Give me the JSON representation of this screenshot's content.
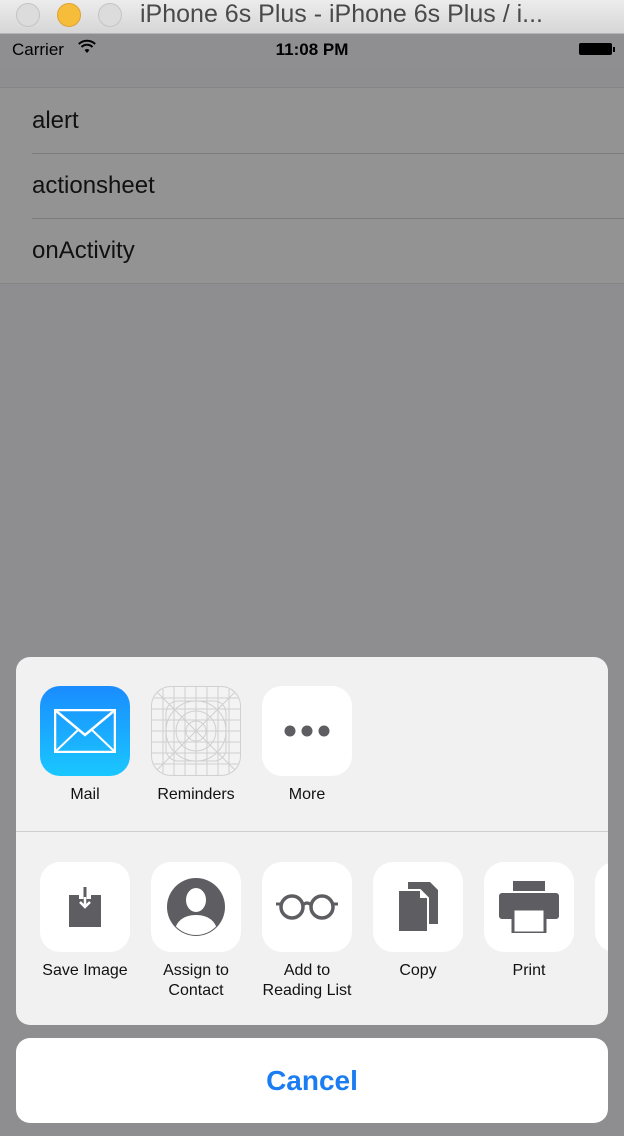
{
  "window": {
    "title": "iPhone 6s Plus - iPhone 6s Plus / i..."
  },
  "statusbar": {
    "carrier": "Carrier",
    "time": "11:08 PM"
  },
  "table": {
    "rows": [
      "alert",
      "actionsheet",
      "onActivity"
    ]
  },
  "share_row": [
    {
      "label": "Mail",
      "icon": "mail-icon"
    },
    {
      "label": "Reminders",
      "icon": "reminders-icon"
    },
    {
      "label": "More",
      "icon": "more-icon"
    }
  ],
  "action_row": [
    {
      "label_line1": "Save Image",
      "label_line2": "",
      "icon": "save-image-icon"
    },
    {
      "label_line1": "Assign to",
      "label_line2": "Contact",
      "icon": "contact-icon"
    },
    {
      "label_line1": "Add to",
      "label_line2": "Reading List",
      "icon": "glasses-icon"
    },
    {
      "label_line1": "Copy",
      "label_line2": "",
      "icon": "copy-icon"
    },
    {
      "label_line1": "Print",
      "label_line2": "",
      "icon": "print-icon"
    }
  ],
  "cancel_label": "Cancel",
  "colors": {
    "accent": "#1a7df2",
    "mail_top": "#1a8cff",
    "mail_bottom": "#1ac7ff"
  }
}
